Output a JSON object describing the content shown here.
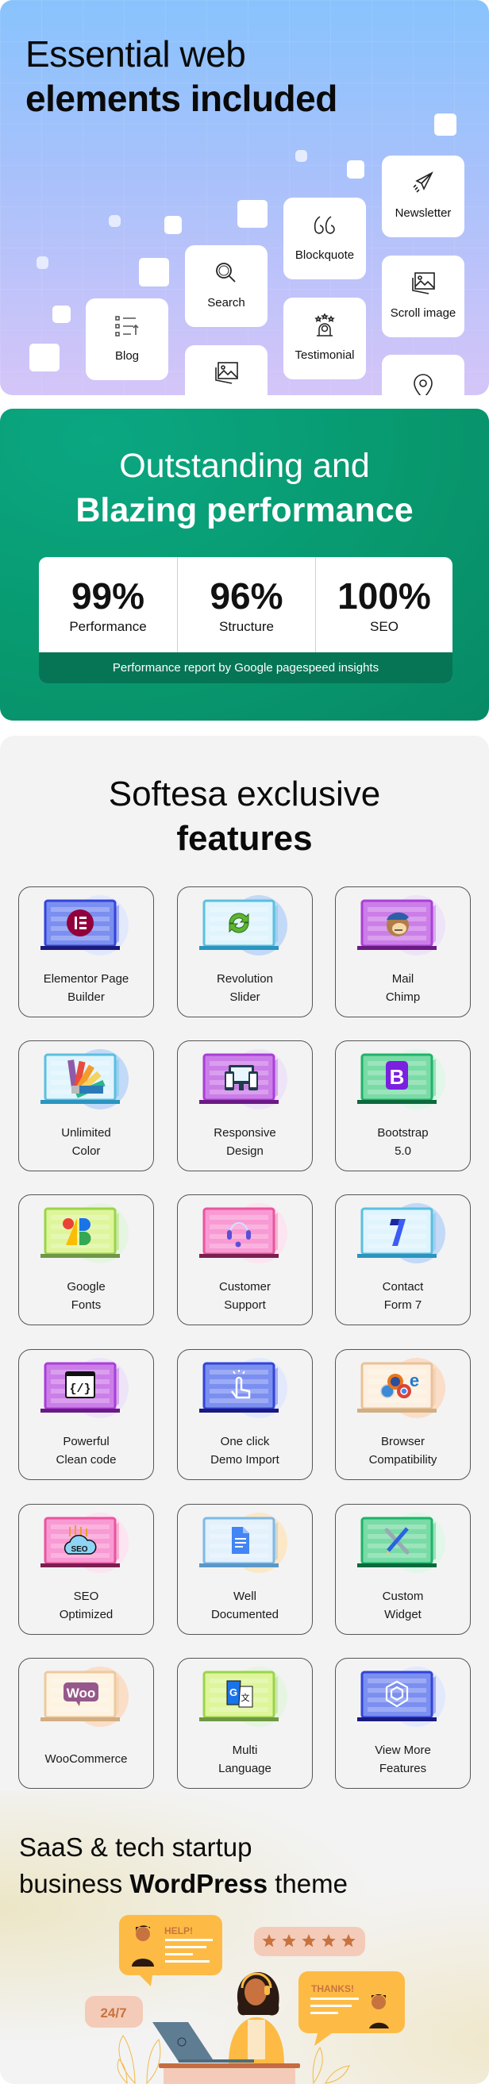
{
  "elements_section": {
    "title_line1": "Essential web",
    "title_line2": "elements included",
    "gradient": [
      "#88c3fd",
      "#d5c5f8"
    ],
    "cards": [
      {
        "label": "Blog",
        "icon": "list-icon"
      },
      {
        "label": "Search",
        "icon": "search-icon"
      },
      {
        "label": "",
        "icon": "image-gallery-icon"
      },
      {
        "label": "Blockquote",
        "icon": "quote-icon"
      },
      {
        "label": "Testimonial",
        "icon": "testimonial-icon"
      },
      {
        "label": "Newsletter",
        "icon": "paper-plane-icon"
      },
      {
        "label": "Scroll image",
        "icon": "image-icon"
      },
      {
        "label": "",
        "icon": "map-pin-icon"
      }
    ]
  },
  "performance_section": {
    "title_line1": "Outstanding and",
    "title_line2": "Blazing performance",
    "stats": [
      {
        "value": "99%",
        "label": "Performance"
      },
      {
        "value": "96%",
        "label": "Structure"
      },
      {
        "value": "100%",
        "label": "SEO"
      }
    ],
    "footer": "Performance report by Google pagespeed insights",
    "colors": {
      "background": "#08996f",
      "footer": "#067556"
    }
  },
  "features_section": {
    "title_line1": "Softesa exclusive",
    "title_line2": "features",
    "features": [
      {
        "line1": "Elementor Page",
        "line2": "Builder",
        "icon": "elementor-logo-icon",
        "screen": "#7b8ff0",
        "frame": "#3344d8",
        "base": "#1a1a80",
        "blob": "#dfe6fd"
      },
      {
        "line1": "Revolution",
        "line2": "Slider",
        "icon": "refresh-arrows-icon",
        "screen": "#dff4fd",
        "frame": "#5bbfe0",
        "base": "#2a95c0",
        "blob": "#b9d3f7"
      },
      {
        "line1": "Mail",
        "line2": "Chimp",
        "icon": "mailchimp-logo-icon",
        "screen": "#cc7ee8",
        "frame": "#a93fd8",
        "base": "#6a1a85",
        "blob": "#ece1f8"
      },
      {
        "line1": "Unlimited",
        "line2": "Color",
        "icon": "color-palette-icon",
        "screen": "#dff4fd",
        "frame": "#5bbfe0",
        "base": "#2a95c0",
        "blob": "#b9d3f7"
      },
      {
        "line1": "Responsive",
        "line2": "Design",
        "icon": "responsive-devices-icon",
        "screen": "#cc7ee8",
        "frame": "#a93fd8",
        "base": "#6a1a85",
        "blob": "#ece1f8"
      },
      {
        "line1": "Bootstrap",
        "line2": "5.0",
        "icon": "bootstrap-logo-icon",
        "screen": "#7adba6",
        "frame": "#1fb36a",
        "base": "#0b6a3d",
        "blob": "#dcf7e6"
      },
      {
        "line1": "Google",
        "line2": "Fonts",
        "icon": "google-fonts-logo-icon",
        "screen": "#def59a",
        "frame": "#9bd44a",
        "base": "#6e9845",
        "blob": "#e3f5dd"
      },
      {
        "line1": "Customer",
        "line2": "Support",
        "icon": "headset-icon",
        "screen": "#f99ad4",
        "frame": "#e8569e",
        "base": "#7a1f50",
        "blob": "#fde0ee"
      },
      {
        "line1": "Contact",
        "line2": "Form 7",
        "icon": "contact-form-7-logo-icon",
        "screen": "#dff4fd",
        "frame": "#5bbfe0",
        "base": "#2a95c0",
        "blob": "#b9d3f7"
      },
      {
        "line1": "Powerful",
        "line2": "Clean code",
        "icon": "code-window-icon",
        "screen": "#cc7ee8",
        "frame": "#a93fd8",
        "base": "#6a1a85",
        "blob": "#ece1f8"
      },
      {
        "line1": "One click",
        "line2": "Demo Import",
        "icon": "hand-click-icon",
        "screen": "#7b8ff0",
        "frame": "#3344d8",
        "base": "#1a1a80",
        "blob": "#dfe6fd"
      },
      {
        "line1": "Browser",
        "line2": "Compatibility",
        "icon": "browsers-icon",
        "screen": "#fdf0e0",
        "frame": "#e8c29a",
        "base": "#d2ae82",
        "blob": "#fbd9bf"
      },
      {
        "line1": "SEO",
        "line2": "Optimized",
        "icon": "seo-cloud-icon",
        "screen": "#f99ad4",
        "frame": "#e8569e",
        "base": "#7a1f50",
        "blob": "#fde0ee"
      },
      {
        "line1": "Well",
        "line2": "Documented",
        "icon": "document-icon",
        "screen": "#e2f1fc",
        "frame": "#7fb8e6",
        "base": "#5a98c8",
        "blob": "#fde5bd"
      },
      {
        "line1": "Custom",
        "line2": "Widget",
        "icon": "wrench-pencil-icon",
        "screen": "#7adba6",
        "frame": "#1fb36a",
        "base": "#0b6a3d",
        "blob": "#dcf7e6"
      },
      {
        "line1": "WooCommerce",
        "line2": "",
        "icon": "woocommerce-logo-icon",
        "screen": "#fdf3e0",
        "frame": "#eccaa0",
        "base": "#d2ae82",
        "blob": "#fbd9bf"
      },
      {
        "line1": "Multi",
        "line2": "Language",
        "icon": "translate-icon",
        "screen": "#def59a",
        "frame": "#9bd44a",
        "base": "#6e9845",
        "blob": "#e3f5dd"
      },
      {
        "line1": "View More",
        "line2": "Features",
        "icon": "hexagon-logo-icon",
        "screen": "#7b8ff0",
        "frame": "#3344d8",
        "base": "#1a1a80",
        "blob": "#dfe6fd"
      }
    ]
  },
  "theme_section": {
    "title_line1": "SaaS & tech startup",
    "title_line2_pre": "business ",
    "title_line2_bold": "WordPress",
    "title_line2_post": " theme",
    "illustration": {
      "help": "HELP!",
      "thanks": "THANKS!",
      "hours": "24/7",
      "rating_stars": 5
    },
    "colors": {
      "bubble": "#fdbb45",
      "pill": "#f4cbb8",
      "accent": "#c8733f",
      "laptop": "#5e7c92"
    }
  }
}
